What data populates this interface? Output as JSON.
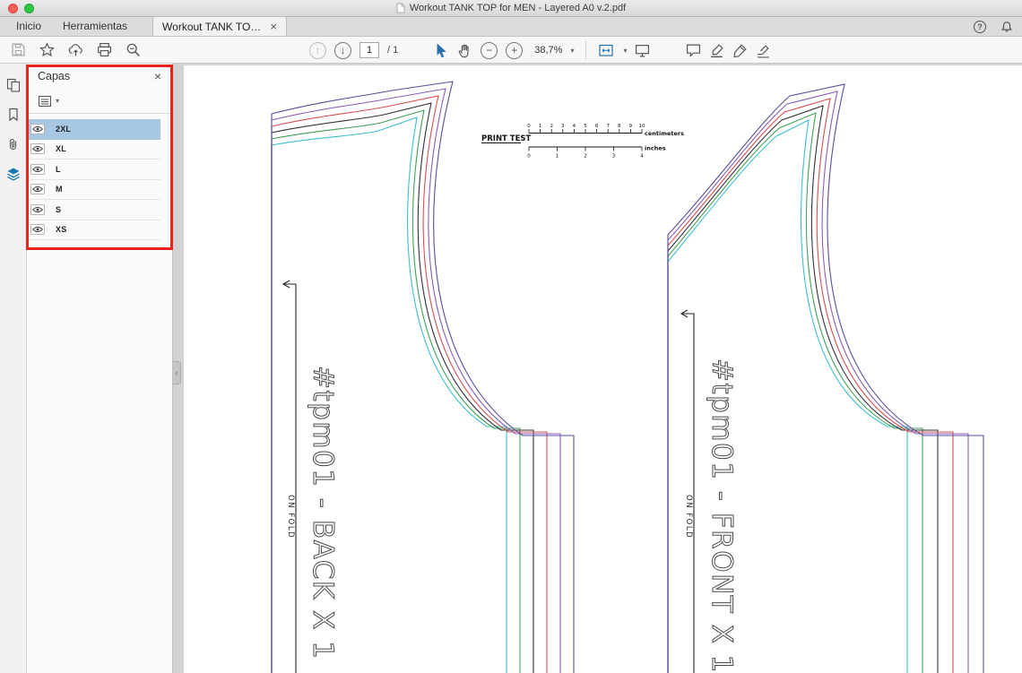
{
  "window": {
    "title": "Workout TANK TOP for MEN - Layered A0 v.2.pdf"
  },
  "tabs": {
    "inicio": "Inicio",
    "herramientas": "Herramientas",
    "document": "Workout TANK TO…",
    "close_glyph": "×"
  },
  "header_icons": {
    "help": "?"
  },
  "toolbar": {
    "page_current": "1",
    "page_total": "/ 1",
    "zoom_level": "38,7%"
  },
  "layers_panel": {
    "title": "Capas",
    "close_glyph": "×",
    "layers": [
      {
        "name": "2XL",
        "selected": true
      },
      {
        "name": "XL",
        "selected": false
      },
      {
        "name": "L",
        "selected": false
      },
      {
        "name": "M",
        "selected": false
      },
      {
        "name": "S",
        "selected": false
      },
      {
        "name": "XS",
        "selected": false
      }
    ]
  },
  "document": {
    "back_label": "#tpm01 - BACK X 1",
    "front_label": "#tpm01 - FRONT X 1",
    "on_fold": "ON FOLD",
    "print_test": {
      "label": "PRINT TEST",
      "cm_ticks": [
        "0",
        "1",
        "2",
        "3",
        "4",
        "5",
        "6",
        "7",
        "8",
        "9",
        "10"
      ],
      "cm_label": "centimeters",
      "inch_ticks": [
        "0",
        "1",
        "2",
        "3",
        "4"
      ],
      "inch_label": "inches"
    },
    "sizes": [
      {
        "name": "XS",
        "color": "#3fc0cc"
      },
      {
        "name": "S",
        "color": "#43a156"
      },
      {
        "name": "M",
        "color": "#333333"
      },
      {
        "name": "L",
        "color": "#d94f4f"
      },
      {
        "name": "XL",
        "color": "#8a5fb5"
      },
      {
        "name": "2XL",
        "color": "#5b4ea0"
      }
    ]
  },
  "annotation": {
    "color": "#e8251d"
  }
}
